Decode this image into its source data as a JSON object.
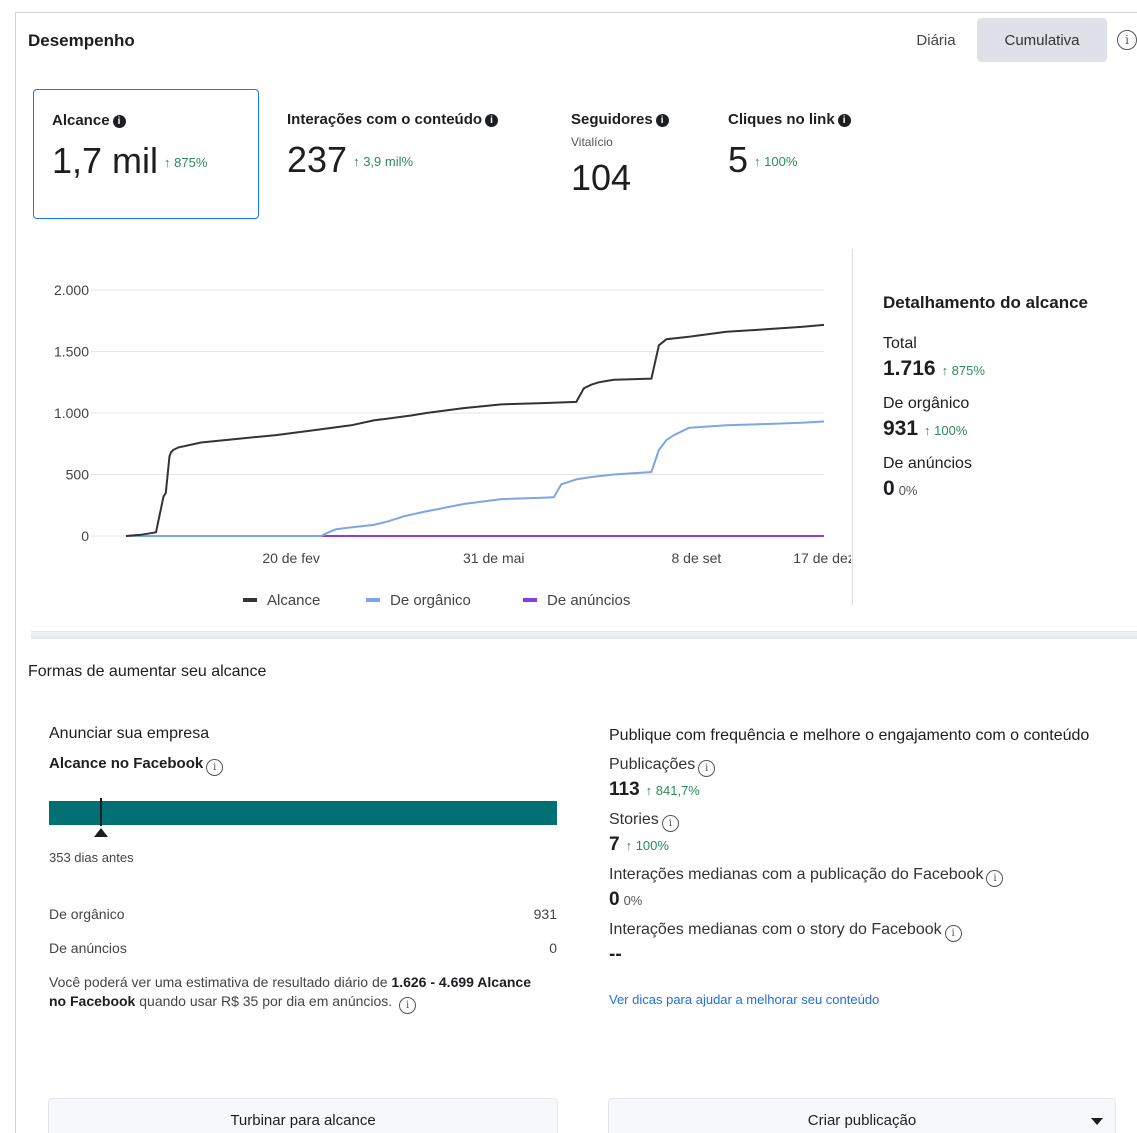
{
  "header": {
    "title": "Desempenho",
    "toggle_daily": "Diária",
    "toggle_cumulative": "Cumulativa",
    "selected_toggle": "Cumulativa"
  },
  "metrics": [
    {
      "label": "Alcance",
      "value": "1,7 mil",
      "delta": "↑ 875%",
      "selected": true
    },
    {
      "label": "Interações com o conteúdo",
      "value": "237",
      "delta": "↑ 3,9 mil%"
    },
    {
      "label": "Seguidores",
      "sub": "Vitalício",
      "value": "104"
    },
    {
      "label": "Cliques no link",
      "value": "5",
      "delta": "↑ 100%"
    }
  ],
  "chart_data": {
    "type": "line",
    "x_ticks": [
      "20 de fev",
      "31 de mai",
      "8 de set",
      "17 de dez"
    ],
    "y_ticks": [
      "2.000",
      "1.500",
      "1.000",
      "500",
      "0"
    ],
    "ylim": [
      0,
      2000
    ],
    "grid": true,
    "legend_position": "bottom",
    "series": [
      {
        "name": "Alcance",
        "color": "#323335",
        "x": [
          0,
          2,
          4,
          5,
          5.3,
          5.8,
          6,
          6.3,
          7,
          10,
          15,
          20,
          25,
          30,
          33,
          38,
          40,
          45,
          50,
          55,
          60,
          61,
          62,
          63,
          64,
          65,
          70,
          71,
          72,
          75,
          80,
          85,
          90,
          93
        ],
        "y": [
          0,
          10,
          30,
          320,
          350,
          650,
          680,
          700,
          720,
          760,
          790,
          820,
          860,
          900,
          940,
          980,
          1000,
          1040,
          1070,
          1080,
          1090,
          1200,
          1230,
          1250,
          1260,
          1270,
          1280,
          1550,
          1600,
          1620,
          1660,
          1680,
          1700,
          1716
        ]
      },
      {
        "name": "De orgânico",
        "color": "#7ca6e8",
        "x": [
          0,
          26,
          27,
          28,
          30,
          33,
          35,
          37,
          40,
          45,
          50,
          55,
          57,
          58,
          60,
          62,
          65,
          70,
          71,
          72,
          73,
          75,
          80,
          85,
          90,
          93
        ],
        "y": [
          0,
          0,
          30,
          55,
          70,
          90,
          120,
          160,
          200,
          260,
          300,
          310,
          315,
          420,
          460,
          480,
          500,
          520,
          700,
          780,
          820,
          880,
          900,
          910,
          920,
          931
        ]
      },
      {
        "name": "De anúncios",
        "color": "#8a3ee0",
        "x": [
          0,
          93
        ],
        "y": [
          0,
          0
        ]
      }
    ]
  },
  "breakdown": {
    "title": "Detalhamento do alcance",
    "total_label": "Total",
    "total_value": "1.716",
    "total_delta": "↑ 875%",
    "organic_label": "De orgânico",
    "organic_value": "931",
    "organic_delta": "↑ 100%",
    "ads_label": "De anúncios",
    "ads_value": "0",
    "ads_delta": "0%"
  },
  "grow": {
    "section_title": "Formas de aumentar seu alcance",
    "left_title": "Anunciar sua empresa",
    "left_sub": "Alcance no Facebook",
    "bar_caption": "353 dias antes",
    "organic_label": "De orgânico",
    "organic_value": "931",
    "ads_label": "De anúncios",
    "ads_value": "0",
    "note_prefix": "Você poderá ver uma estimativa de resultado diário de ",
    "note_bold": "1.626 - 4.699 Alcance no Facebook",
    "note_suffix": " quando usar R$ 35 por dia em anúncios.",
    "boost_button": "Turbinar para alcance",
    "right_title": "Publique com frequência e melhore o engajamento com o conteúdo",
    "pubs_label": "Publicações",
    "pubs_value": "113",
    "pubs_delta": "↑ 841,7%",
    "stories_label": "Stories",
    "stories_value": "7",
    "stories_delta": "↑ 100%",
    "median_pub_label": "Interações medianas com a publicação do Facebook",
    "median_pub_value": "0",
    "median_pub_delta": "0%",
    "median_story_label": "Interações medianas com o story do Facebook",
    "median_story_value": "--",
    "tips_link": "Ver dicas para ajudar a melhorar seu conteúdo",
    "create_button": "Criar publicação"
  }
}
